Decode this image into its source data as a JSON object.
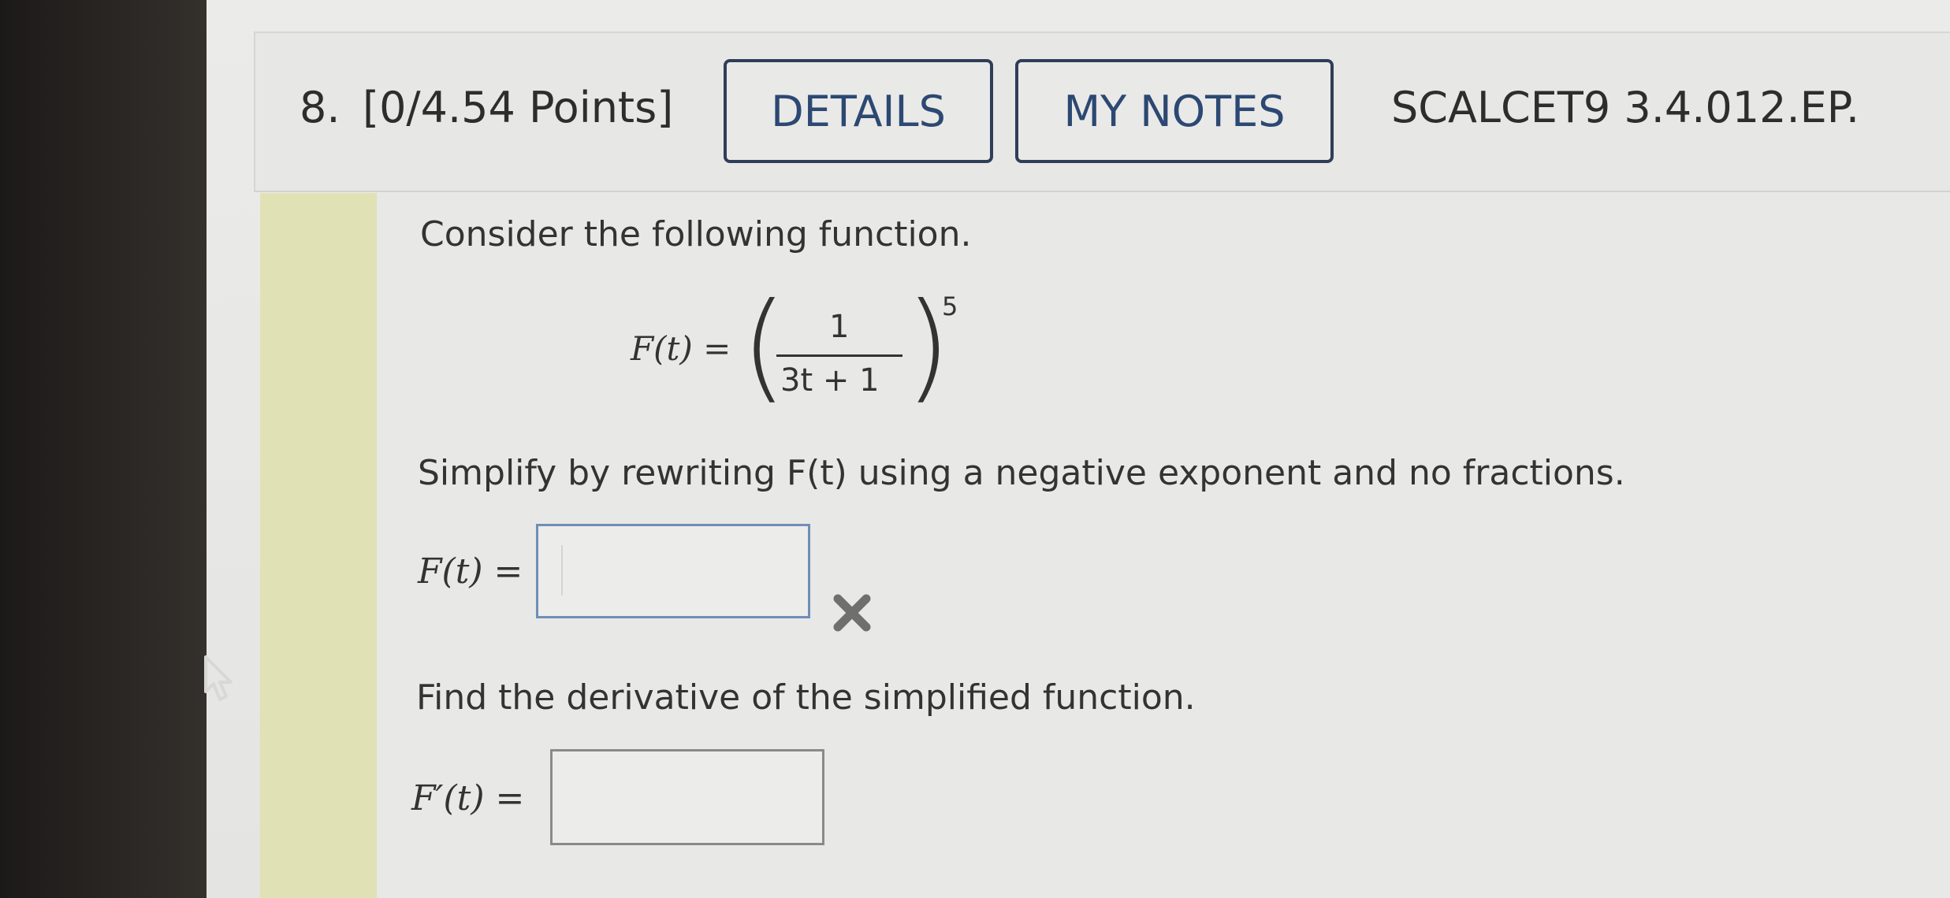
{
  "question": {
    "number": "8.",
    "points": "[0/4.54 Points]",
    "details_label": "DETAILS",
    "notes_label": "MY NOTES",
    "source": "SCALCET9 3.4.012.EP."
  },
  "body": {
    "intro": "Consider the following function.",
    "formula": {
      "lhs": "F(t) =",
      "numerator": "1",
      "denominator": "3t + 1",
      "exponent": "5"
    },
    "prompt1": "Simplify by rewriting F(t) using a negative exponent and no fractions.",
    "answer1_label": "F(t) =",
    "answer1_value": "",
    "answer1_status": "incorrect",
    "prompt2": "Find the derivative of the simplified function.",
    "answer2_label": "F′(t) =",
    "answer2_value": ""
  },
  "icons": {
    "incorrect": "x-mark-icon",
    "cursor": "mouse-pointer-icon"
  },
  "colors": {
    "button_border": "#2f3e58",
    "button_text": "#2c4873",
    "stripe": "#e0e2b6",
    "wrong_mark": "#6f6f6d"
  }
}
